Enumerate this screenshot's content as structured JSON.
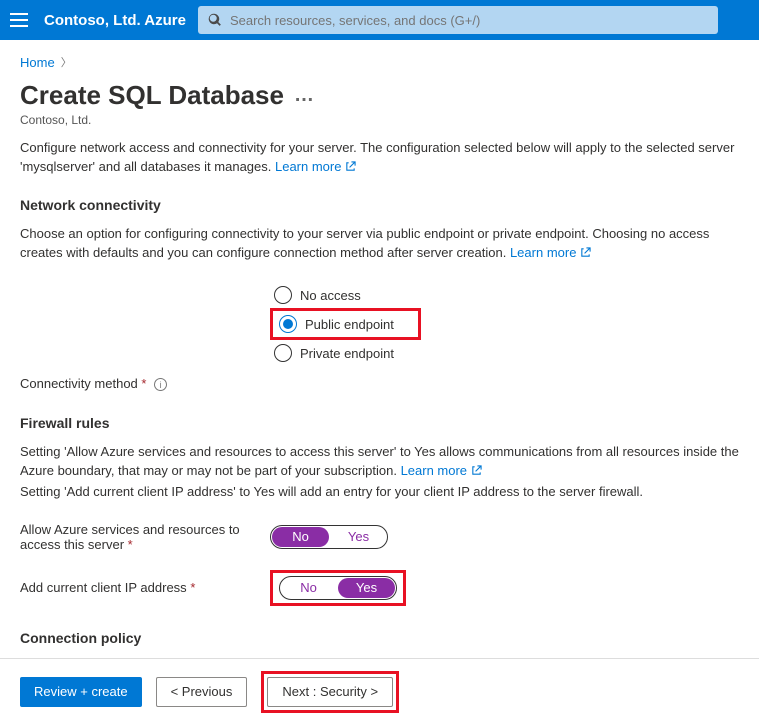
{
  "topbar": {
    "brand": "Contoso, Ltd. Azure",
    "search_placeholder": "Search resources, services, and docs (G+/)"
  },
  "breadcrumb": {
    "home": "Home"
  },
  "page": {
    "title": "Create SQL Database",
    "subtitle": "Contoso, Ltd.",
    "intro": "Configure network access and connectivity for your server. The configuration selected below will apply to the selected server 'mysqlserver' and all databases it manages. ",
    "learn_more": "Learn more"
  },
  "network": {
    "heading": "Network connectivity",
    "desc": "Choose an option for configuring connectivity to your server via public endpoint or private endpoint. Choosing no access creates with defaults and you can configure connection method after server creation. ",
    "learn_more": "Learn more",
    "field_label": "Connectivity method",
    "options": {
      "no_access": "No access",
      "public": "Public endpoint",
      "private": "Private endpoint"
    }
  },
  "firewall": {
    "heading": "Firewall rules",
    "desc1": "Setting 'Allow Azure services and resources to access this server' to Yes allows communications from all resources inside the Azure boundary, that may or may not be part of your subscription. ",
    "learn_more": "Learn more",
    "desc2": "Setting 'Add current client IP address' to Yes will add an entry for your client IP address to the server firewall.",
    "allow_label": "Allow Azure services and resources to access this server",
    "addip_label": "Add current client IP address",
    "no": "No",
    "yes": "Yes"
  },
  "policy": {
    "heading": "Connection policy"
  },
  "footer": {
    "review": "Review + create",
    "previous": "< Previous",
    "next": "Next : Security >"
  }
}
